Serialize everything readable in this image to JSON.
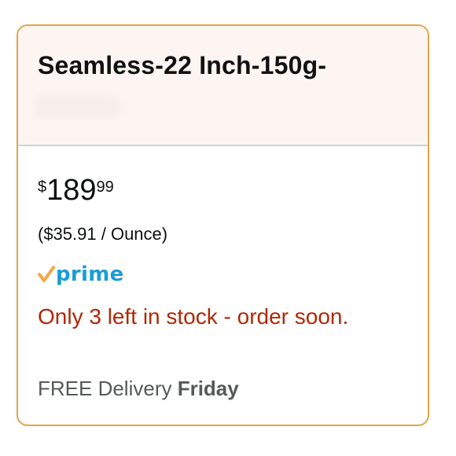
{
  "product": {
    "title": "Seamless-22 Inch-150g-"
  },
  "price": {
    "currency_symbol": "$",
    "whole": "189",
    "fraction": "99",
    "unit_price": "($35.91 / Ounce)"
  },
  "prime": {
    "label": "prime",
    "icon": "prime-check-icon",
    "colors": {
      "check": "#f3a847",
      "text": "#1b9bd7"
    }
  },
  "availability": {
    "text": "Only 3 left in stock - order soon.",
    "color": "#b12704"
  },
  "delivery": {
    "prefix": "FREE Delivery ",
    "day": "Friday"
  },
  "colors": {
    "card_border": "#e1a549",
    "header_background": "#fcf5f2",
    "divider": "#d0d2d3"
  }
}
